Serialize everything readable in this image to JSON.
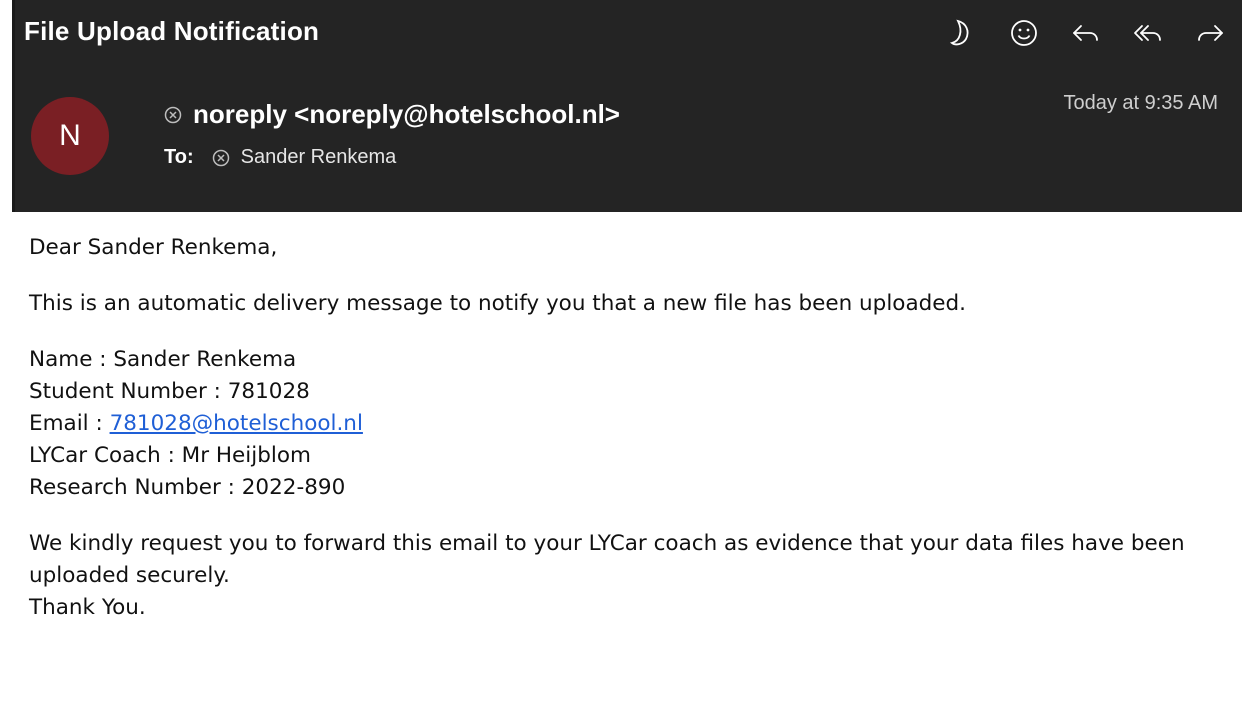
{
  "header": {
    "subject": "File Upload Notification",
    "toolbar": [
      {
        "icon": "moon-icon",
        "name": "moon-button"
      },
      {
        "icon": "smiley-icon",
        "name": "emoji-button"
      },
      {
        "icon": "reply-icon",
        "name": "reply-button"
      },
      {
        "icon": "reply-all-icon",
        "name": "reply-all-button"
      },
      {
        "icon": "forward-icon",
        "name": "forward-button"
      }
    ],
    "avatar_initial": "N",
    "avatar_color": "#7a1f24",
    "from": "noreply <noreply@hotelschool.nl>",
    "to_label": "To:",
    "to": "Sander Renkema",
    "date": "Today at 9:35 AM"
  },
  "body": {
    "greeting": "Dear Sander Renkema,",
    "intro": "This is an automatic delivery message to notify you that a new file has been uploaded.",
    "fields": {
      "name": "Name : Sander Renkema",
      "student_number": "Student Number : 781028",
      "email_label": "Email : ",
      "email_link": "781028@hotelschool.nl",
      "coach": "LYCar Coach : Mr Heijblom",
      "research_number": "Research Number : 2022-890"
    },
    "request": "We kindly request you to forward this email to your LYCar coach as evidence that your data files have been uploaded securely.",
    "closing": "Thank You."
  },
  "colors": {
    "header_bg": "#242424",
    "link": "#1f5fd6"
  }
}
